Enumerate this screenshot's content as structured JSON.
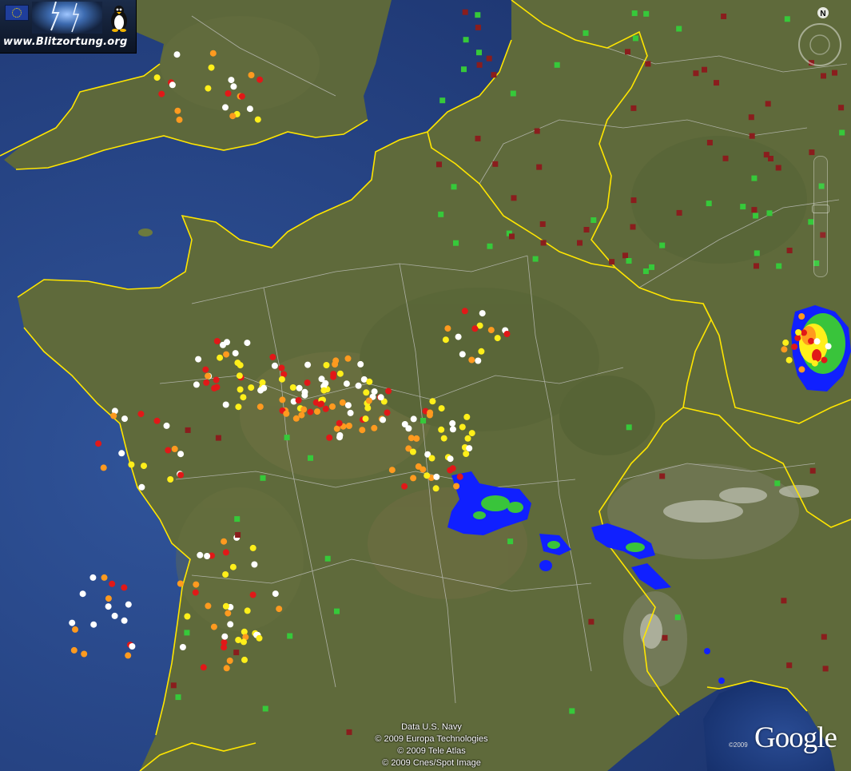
{
  "map": {
    "logo_text": "www.Blitzortung.org",
    "compass_label": "N",
    "attribution": [
      "Data U.S. Navy",
      "© 2009 Europa Technologies",
      "© 2009 Tele Atlas",
      "© 2009 Cnes/Spot Image"
    ],
    "google_copyright": "©2009",
    "google_logo": "Google",
    "colors": {
      "ocean": "#2b4a85",
      "land": "#5f6a3b",
      "border": "#ffe600",
      "region_line": "#c9c9c9",
      "strike_white": "#ffffff",
      "strike_yellow": "#ffef1a",
      "strike_orange": "#ff9a1f",
      "strike_red": "#e11818",
      "station_green": "#36c93a",
      "station_darkred": "#8a1d1d",
      "radar_blue": "#1020ff",
      "radar_green": "#39c43b"
    },
    "icons": [
      "eu-flag-icon",
      "lightning-icon",
      "tux-icon",
      "compass-icon",
      "zoom-slider-icon"
    ]
  }
}
